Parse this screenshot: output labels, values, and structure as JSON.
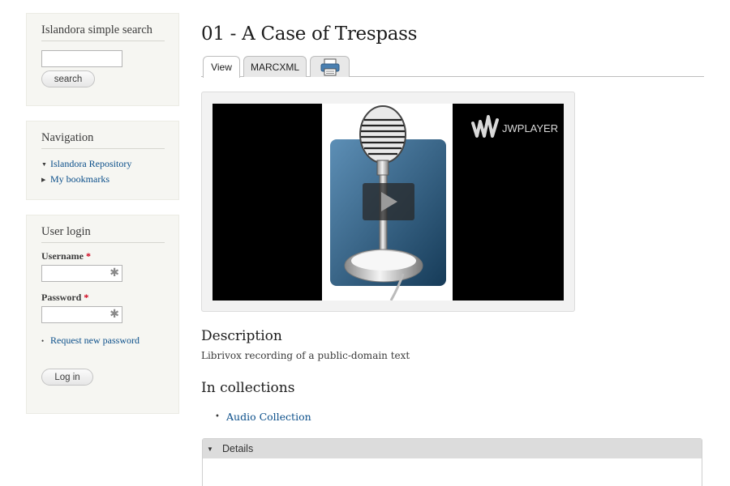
{
  "sidebar": {
    "search": {
      "title": "Islandora simple search",
      "input_value": "",
      "button_label": "search"
    },
    "navigation": {
      "title": "Navigation",
      "items": [
        {
          "label": "Islandora Repository",
          "expanded": true
        },
        {
          "label": "My bookmarks",
          "expanded": false
        }
      ]
    },
    "login": {
      "title": "User login",
      "username_label": "Username",
      "password_label": "Password",
      "required_marker": "*",
      "username_value": "",
      "password_value": "",
      "request_password_link": "Request new password",
      "login_button": "Log in"
    }
  },
  "main": {
    "title": "01 - A Case of Trespass",
    "tabs": [
      {
        "label": "View",
        "active": true
      },
      {
        "label": "MARCXML",
        "active": false
      },
      {
        "label": "",
        "icon": "print-icon",
        "active": false
      }
    ],
    "player": {
      "brand": "JWPLAYER",
      "thumbnail_icon": "microphone-icon",
      "control_icon": "play-icon"
    },
    "description": {
      "title": "Description",
      "text": "Librivox recording of a public-domain text"
    },
    "collections": {
      "title": "In collections",
      "items": [
        "Audio Collection"
      ]
    },
    "details": {
      "title": "Details",
      "expanded": true
    }
  },
  "colors": {
    "link": "#0b4f8a",
    "sidebar_bg": "#f6f6f2",
    "required": "#d0021b",
    "player_bg": "#000000"
  }
}
